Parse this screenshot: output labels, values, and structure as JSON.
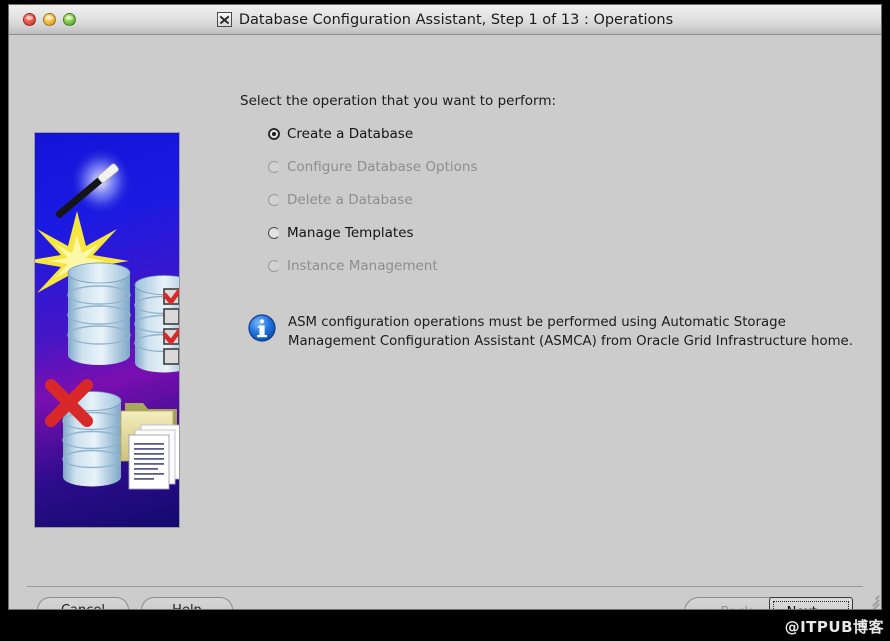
{
  "window": {
    "title": "Database Configuration Assistant, Step 1 of 13 : Operations",
    "app_icon": "x-box-icon",
    "controls": {
      "close": "close-button",
      "minimize": "minimize-button",
      "zoom": "zoom-button"
    }
  },
  "main": {
    "prompt": "Select the operation that you want to perform:",
    "options": [
      {
        "label": "Create a Database",
        "selected": true,
        "enabled": true
      },
      {
        "label": "Configure Database Options",
        "selected": false,
        "enabled": false
      },
      {
        "label": "Delete a Database",
        "selected": false,
        "enabled": false
      },
      {
        "label": "Manage Templates",
        "selected": false,
        "enabled": true
      },
      {
        "label": "Instance Management",
        "selected": false,
        "enabled": false
      }
    ],
    "note": {
      "icon": "info-icon",
      "text": "ASM configuration operations must be performed using Automatic Storage Management Configuration Assistant (ASMCA) from Oracle Grid Infrastructure home."
    },
    "artwork": {
      "name": "dbca-splash-illustration",
      "elements": [
        "magic-wand-icon",
        "sparkle-icon",
        "database-cylinder-icon",
        "checklist-icon",
        "red-x-icon",
        "folder-icon",
        "documents-icon"
      ]
    }
  },
  "footer": {
    "cancel_label": "Cancel",
    "help_label": "Help",
    "back_label": "Back",
    "back_mnemonic": "B",
    "back_enabled": false,
    "next_label": "Next",
    "next_mnemonic": "N",
    "next_enabled": true,
    "back_chevron": "«",
    "next_chevron": "»"
  },
  "watermark": {
    "text": "@ITPUB博客"
  },
  "colors": {
    "window_bg": "#cccccc",
    "titlebar_top": "#f0f0f0",
    "titlebar_bottom": "#bdbdbd",
    "art_blue": "#1313d8",
    "art_purple": "#7a0fb0",
    "info_blue": "#1769d8",
    "disabled_text": "#8d8d8d",
    "text": "#1c1c1c",
    "check_red": "#d8282a"
  }
}
